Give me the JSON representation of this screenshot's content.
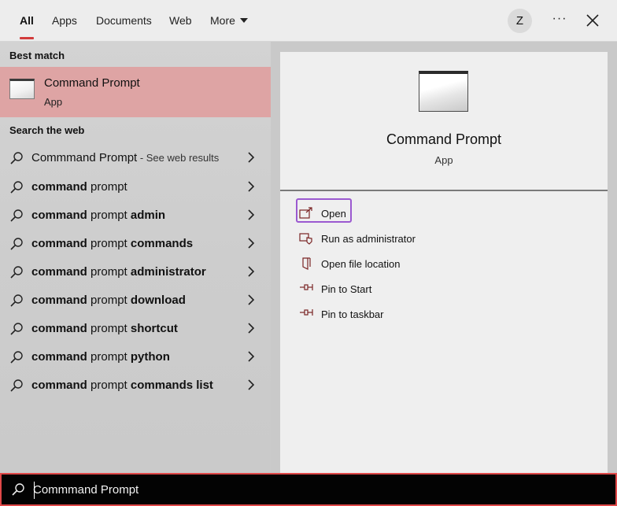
{
  "tabs": [
    {
      "label": "All",
      "active": true
    },
    {
      "label": "Apps"
    },
    {
      "label": "Documents"
    },
    {
      "label": "Web"
    },
    {
      "label": "More"
    }
  ],
  "user_initial": "Z",
  "more_options_glyph": "···",
  "best_match": {
    "section_title": "Best match",
    "name": "Command Prompt",
    "type": "App",
    "icon": "command-prompt-icon"
  },
  "search_web": {
    "section_title": "Search the web",
    "items": [
      {
        "bold": "",
        "normal": "Commmand Prompt",
        "suffix": " - See web results"
      },
      {
        "bold": "command",
        "normal": " prompt",
        "suffix": ""
      },
      {
        "bold": "command",
        "normal": " prompt ",
        "suffix": "",
        "bold2": "admin"
      },
      {
        "bold": "command",
        "normal": " prompt ",
        "suffix": "",
        "bold2": "commands"
      },
      {
        "bold": "command",
        "normal": " prompt ",
        "suffix": "",
        "bold2": "administrator"
      },
      {
        "bold": "command",
        "normal": " prompt ",
        "suffix": "",
        "bold2": "download"
      },
      {
        "bold": "command",
        "normal": " prompt ",
        "suffix": "",
        "bold2": "shortcut"
      },
      {
        "bold": "command",
        "normal": " prompt ",
        "suffix": "",
        "bold2": "python"
      },
      {
        "bold": "command",
        "normal": " prompt ",
        "suffix": "",
        "bold2": "commands list"
      }
    ]
  },
  "preview": {
    "title": "Command Prompt",
    "subtitle": "App",
    "actions": [
      {
        "label": "Open",
        "icon": "open-icon",
        "highlighted": true
      },
      {
        "label": "Run as administrator",
        "icon": "run-as-admin-icon"
      },
      {
        "label": "Open file location",
        "icon": "file-location-icon"
      },
      {
        "label": "Pin to Start",
        "icon": "pin-icon"
      },
      {
        "label": "Pin to taskbar",
        "icon": "pin-icon"
      }
    ]
  },
  "search": {
    "query": "Commmand Prompt"
  },
  "colors": {
    "accent": "#d23b3b",
    "best_match_bg": "#dea4a4",
    "highlight_outline": "#9b59d0",
    "search_border": "#e04848"
  }
}
